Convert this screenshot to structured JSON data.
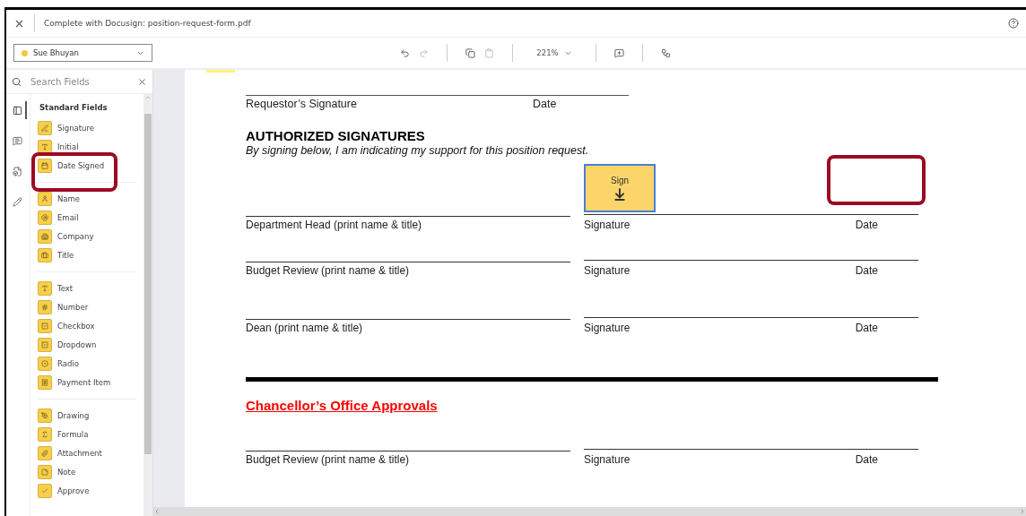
{
  "window": {
    "title": "Complete with Docusign: position-request-form.pdf"
  },
  "recipient": {
    "name": "Sue Bhuyan",
    "color": "#f5c542"
  },
  "toolbar": {
    "zoom": "221%"
  },
  "rail": [
    {
      "selected": true
    },
    {
      "selected": false
    },
    {
      "selected": false
    },
    {
      "selected": false
    }
  ],
  "sidebar": {
    "search": {
      "placeholder": "Search Fields"
    },
    "section_title": "Standard Fields",
    "groups": [
      [
        "Signature",
        "Initial",
        "Date Signed"
      ],
      [
        "Name",
        "Email",
        "Company",
        "Title"
      ],
      [
        "Text",
        "Number",
        "Checkbox",
        "Dropdown",
        "Radio",
        "Payment Item"
      ],
      [
        "Drawing",
        "Formula",
        "Attachment",
        "Note",
        "Approve"
      ]
    ]
  },
  "document": {
    "requestor": {
      "signature_label": "Requestor’s Signature",
      "date_label": "Date"
    },
    "heading": "AUTHORIZED SIGNATURES",
    "subheading": "By signing below, I am indicating my support for this position request.",
    "sign_tag": {
      "label": "Sign"
    },
    "rows": [
      {
        "name_label": "Department Head (print name & title)",
        "signature_label": "Signature",
        "date_label": "Date"
      },
      {
        "name_label": "Budget Review (print name & title)",
        "signature_label": "Signature",
        "date_label": "Date"
      },
      {
        "name_label": "Dean (print name & title)",
        "signature_label": "Signature",
        "date_label": "Date"
      }
    ],
    "section_title": "Chancellor’s Office Approvals",
    "office_rows": [
      {
        "name_label": "Budget Review (print name & title)",
        "signature_label": "Signature",
        "date_label": "Date"
      }
    ]
  }
}
